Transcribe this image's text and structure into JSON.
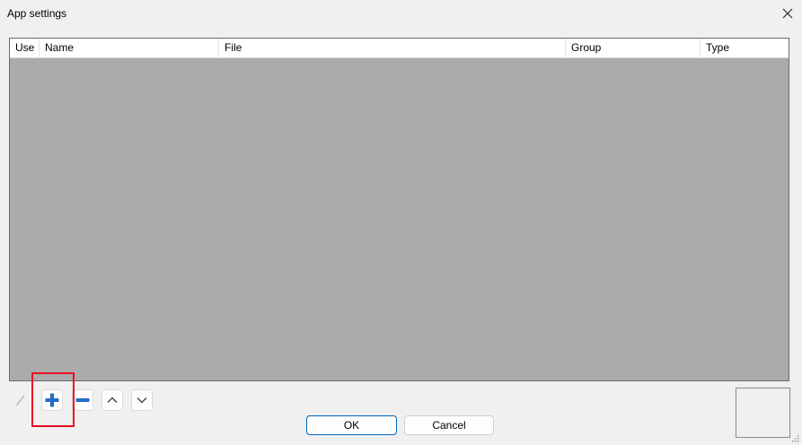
{
  "window": {
    "title": "App settings",
    "close_icon": "close-icon"
  },
  "table": {
    "columns": [
      "Use",
      "Name",
      "File",
      "Group",
      "Type"
    ],
    "rows": []
  },
  "toolbar": {
    "buttons": [
      {
        "name": "edit-button",
        "icon": "pencil-icon",
        "enabled": false
      },
      {
        "name": "add-button",
        "icon": "plus-icon",
        "enabled": true
      },
      {
        "name": "remove-button",
        "icon": "minus-icon",
        "enabled": true
      },
      {
        "name": "move-up-button",
        "icon": "chevron-up-icon",
        "enabled": true
      },
      {
        "name": "move-down-button",
        "icon": "chevron-down-icon",
        "enabled": true
      }
    ]
  },
  "dialog_buttons": {
    "ok_label": "OK",
    "cancel_label": "Cancel"
  },
  "colors": {
    "accent": "#0067c0",
    "highlight": "#e81123",
    "grid_background": "#ababab",
    "plus_icon": "#1e73d8"
  }
}
